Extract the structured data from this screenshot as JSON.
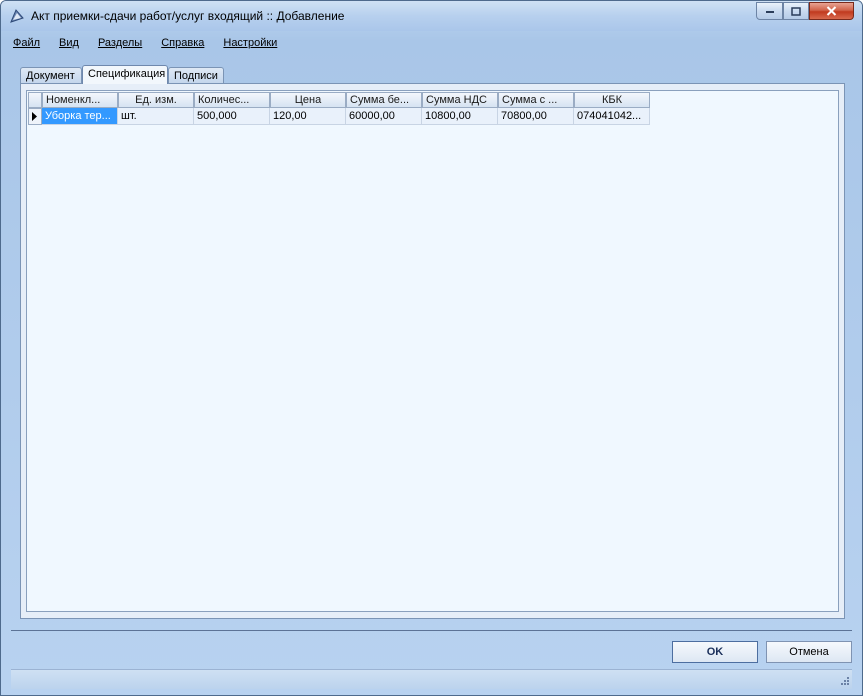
{
  "window": {
    "title": "Акт приемки-сдачи работ/услуг входящий :: Добавление"
  },
  "menu": [
    "Файл",
    "Вид",
    "Разделы",
    "Справка",
    "Настройки"
  ],
  "tabs": [
    {
      "label": "Документ",
      "active": false
    },
    {
      "label": "Спецификация",
      "active": true
    },
    {
      "label": "Подписи",
      "active": false
    }
  ],
  "grid": {
    "columns": [
      "Номенкл...",
      "Ед. изм.",
      "Количес...",
      "Цена",
      "Сумма бе...",
      "Сумма НДС",
      "Сумма с ...",
      "КБК"
    ],
    "rows": [
      [
        "Уборка тер...",
        "шт.",
        "500,000",
        "120,00",
        "60000,00",
        "10800,00",
        "70800,00",
        "074041042..."
      ]
    ]
  },
  "buttons": {
    "ok": "OK",
    "cancel": "Отмена"
  },
  "colors": {
    "selection": "#3399ff",
    "grid_background": "#f0f8ff",
    "window_frame": "#b8d2f0"
  }
}
